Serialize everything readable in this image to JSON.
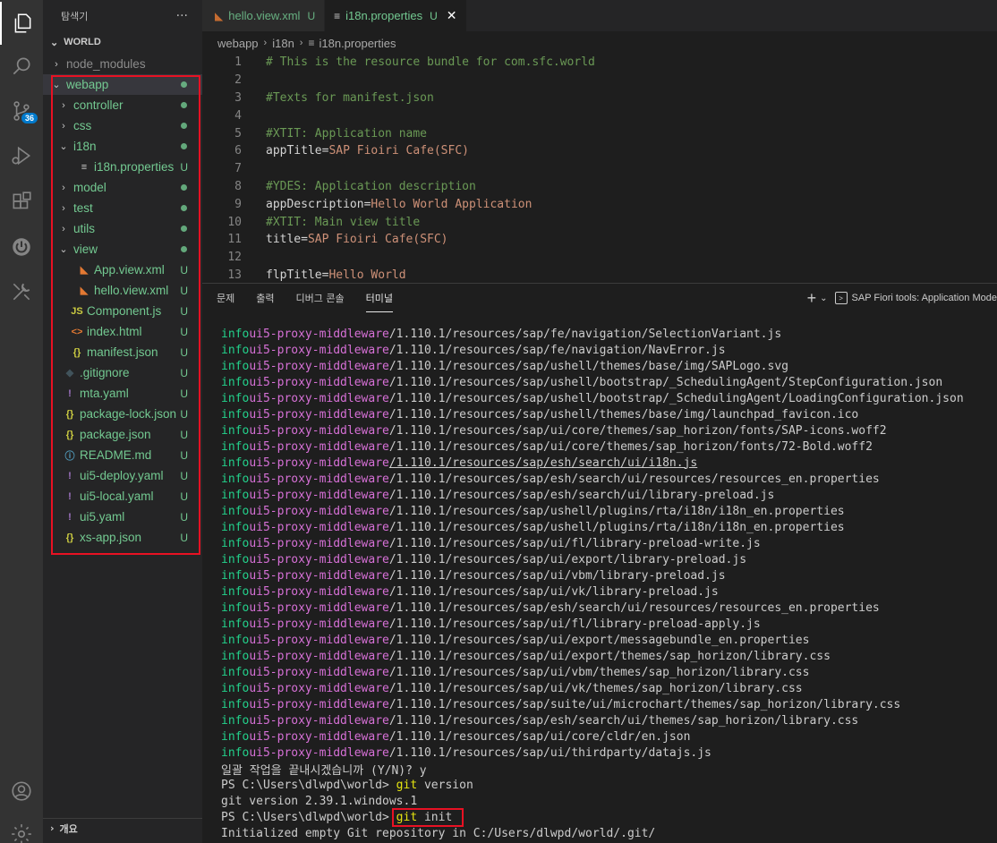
{
  "activity_bar": {
    "items": [
      {
        "icon": "explorer-icon"
      },
      {
        "icon": "search-icon"
      },
      {
        "icon": "source-control-icon",
        "badge": "36"
      },
      {
        "icon": "run-debug-icon"
      },
      {
        "icon": "extensions-icon"
      },
      {
        "icon": "sap-fiori-icon"
      },
      {
        "icon": "tools-icon"
      }
    ],
    "bottom": [
      {
        "icon": "account-icon"
      },
      {
        "icon": "settings-gear-icon"
      }
    ]
  },
  "sidebar": {
    "title": "탐색기",
    "more": "···",
    "root": "WORLD",
    "outline": "개요",
    "items": [
      {
        "label": "node_modules",
        "chev": "›",
        "depth": 0,
        "icon": "",
        "status": "",
        "color": "gray"
      },
      {
        "label": "webapp",
        "chev": "⌄",
        "depth": 0,
        "icon": "",
        "status": "dot",
        "color": "green",
        "selected": true
      },
      {
        "label": "controller",
        "chev": "›",
        "depth": 1,
        "icon": "",
        "status": "dot",
        "color": "green"
      },
      {
        "label": "css",
        "chev": "›",
        "depth": 1,
        "icon": "",
        "status": "dot",
        "color": "green"
      },
      {
        "label": "i18n",
        "chev": "⌄",
        "depth": 1,
        "icon": "",
        "status": "dot",
        "color": "green"
      },
      {
        "label": "i18n.properties",
        "chev": "",
        "depth": 2,
        "icon": "≡",
        "iconColor": "#cccccc",
        "status": "U",
        "color": "green"
      },
      {
        "label": "model",
        "chev": "›",
        "depth": 1,
        "icon": "",
        "status": "dot",
        "color": "green"
      },
      {
        "label": "test",
        "chev": "›",
        "depth": 1,
        "icon": "",
        "status": "dot",
        "color": "green"
      },
      {
        "label": "utils",
        "chev": "›",
        "depth": 1,
        "icon": "",
        "status": "dot",
        "color": "green"
      },
      {
        "label": "view",
        "chev": "⌄",
        "depth": 1,
        "icon": "",
        "status": "dot",
        "color": "green"
      },
      {
        "label": "App.view.xml",
        "chev": "",
        "depth": 2,
        "icon": "◣",
        "iconColor": "#e37933",
        "status": "U",
        "color": "green"
      },
      {
        "label": "hello.view.xml",
        "chev": "",
        "depth": 2,
        "icon": "◣",
        "iconColor": "#e37933",
        "status": "U",
        "color": "green"
      },
      {
        "label": "Component.js",
        "chev": "",
        "depth": 1,
        "icon": "JS",
        "iconColor": "#cbcb41",
        "status": "U",
        "color": "green"
      },
      {
        "label": "index.html",
        "chev": "",
        "depth": 1,
        "icon": "<>",
        "iconColor": "#e37933",
        "status": "U",
        "color": "green"
      },
      {
        "label": "manifest.json",
        "chev": "",
        "depth": 1,
        "icon": "{}",
        "iconColor": "#cbcb41",
        "status": "U",
        "color": "green"
      },
      {
        "label": ".gitignore",
        "chev": "",
        "depth": 0,
        "icon": "◆",
        "iconColor": "#41535b",
        "status": "U",
        "color": "green"
      },
      {
        "label": "mta.yaml",
        "chev": "",
        "depth": 0,
        "icon": "!",
        "iconColor": "#a074c4",
        "status": "U",
        "color": "green"
      },
      {
        "label": "package-lock.json",
        "chev": "",
        "depth": 0,
        "icon": "{}",
        "iconColor": "#cbcb41",
        "status": "U",
        "color": "green"
      },
      {
        "label": "package.json",
        "chev": "",
        "depth": 0,
        "icon": "{}",
        "iconColor": "#cbcb41",
        "status": "U",
        "color": "green"
      },
      {
        "label": "README.md",
        "chev": "",
        "depth": 0,
        "icon": "ⓘ",
        "iconColor": "#519aba",
        "status": "U",
        "color": "green"
      },
      {
        "label": "ui5-deploy.yaml",
        "chev": "",
        "depth": 0,
        "icon": "!",
        "iconColor": "#a074c4",
        "status": "U",
        "color": "green"
      },
      {
        "label": "ui5-local.yaml",
        "chev": "",
        "depth": 0,
        "icon": "!",
        "iconColor": "#a074c4",
        "status": "U",
        "color": "green"
      },
      {
        "label": "ui5.yaml",
        "chev": "",
        "depth": 0,
        "icon": "!",
        "iconColor": "#a074c4",
        "status": "U",
        "color": "green"
      },
      {
        "label": "xs-app.json",
        "chev": "",
        "depth": 0,
        "icon": "{}",
        "iconColor": "#cbcb41",
        "status": "U",
        "color": "green"
      }
    ]
  },
  "tabs": [
    {
      "label": "hello.view.xml",
      "icon": "◣",
      "status": "U",
      "active": false
    },
    {
      "label": "i18n.properties",
      "icon": "≡",
      "status": "U",
      "active": true,
      "close": "✕"
    }
  ],
  "breadcrumb": [
    "webapp",
    "i18n",
    "i18n.properties"
  ],
  "editor": {
    "lines": [
      {
        "n": "1",
        "type": "comment",
        "text": "# This is the resource bundle for com.sfc.world"
      },
      {
        "n": "2",
        "type": "blank",
        "text": ""
      },
      {
        "n": "3",
        "type": "comment",
        "text": "#Texts for manifest.json"
      },
      {
        "n": "4",
        "type": "blank",
        "text": ""
      },
      {
        "n": "5",
        "type": "comment",
        "text": "#XTIT: Application name"
      },
      {
        "n": "6",
        "type": "kv",
        "key": "appTitle",
        "value": "SAP Fioiri Cafe(SFC)"
      },
      {
        "n": "7",
        "type": "blank",
        "text": ""
      },
      {
        "n": "8",
        "type": "comment",
        "text": "#YDES: Application description"
      },
      {
        "n": "9",
        "type": "kv",
        "key": "appDescription",
        "value": "Hello World Application"
      },
      {
        "n": "10",
        "type": "comment",
        "text": "#XTIT: Main view title"
      },
      {
        "n": "11",
        "type": "kv",
        "key": "title",
        "value": "SAP Fioiri Cafe(SFC)"
      },
      {
        "n": "12",
        "type": "blank",
        "text": ""
      },
      {
        "n": "13",
        "type": "kv",
        "key": "flpTitle",
        "value": "Hello World"
      }
    ]
  },
  "panel": {
    "tabs": [
      "문제",
      "출력",
      "디버그 콘솔",
      "터미널"
    ],
    "active_tab": "터미널",
    "plus": "+",
    "dropdown": "⌄",
    "terminal_name": "SAP Fiori tools: Application Mode"
  },
  "terminal": {
    "log_level": "info",
    "middleware": "ui5-proxy-middleware",
    "paths": [
      "/1.110.1/resources/sap/fe/navigation/SelectionVariant.js",
      "/1.110.1/resources/sap/fe/navigation/NavError.js",
      "/1.110.1/resources/sap/ushell/themes/base/img/SAPLogo.svg",
      "/1.110.1/resources/sap/ushell/bootstrap/_SchedulingAgent/StepConfiguration.json",
      "/1.110.1/resources/sap/ushell/bootstrap/_SchedulingAgent/LoadingConfiguration.json",
      "/1.110.1/resources/sap/ushell/themes/base/img/launchpad_favicon.ico",
      "/1.110.1/resources/sap/ui/core/themes/sap_horizon/fonts/SAP-icons.woff2",
      "/1.110.1/resources/sap/ui/core/themes/sap_horizon/fonts/72-Bold.woff2",
      "/1.110.1/resources/sap/esh/search/ui/i18n.js",
      "/1.110.1/resources/sap/esh/search/ui/resources/resources_en.properties",
      "/1.110.1/resources/sap/esh/search/ui/library-preload.js",
      "/1.110.1/resources/sap/ushell/plugins/rta/i18n/i18n_en.properties",
      "/1.110.1/resources/sap/ushell/plugins/rta/i18n/i18n_en.properties",
      "/1.110.1/resources/sap/ui/fl/library-preload-write.js",
      "/1.110.1/resources/sap/ui/export/library-preload.js",
      "/1.110.1/resources/sap/ui/vbm/library-preload.js",
      "/1.110.1/resources/sap/ui/vk/library-preload.js",
      "/1.110.1/resources/sap/esh/search/ui/resources/resources_en.properties",
      "/1.110.1/resources/sap/ui/fl/library-preload-apply.js",
      "/1.110.1/resources/sap/ui/export/messagebundle_en.properties",
      "/1.110.1/resources/sap/ui/export/themes/sap_horizon/library.css",
      "/1.110.1/resources/sap/ui/vbm/themes/sap_horizon/library.css",
      "/1.110.1/resources/sap/ui/vk/themes/sap_horizon/library.css",
      "/1.110.1/resources/sap/suite/ui/microchart/themes/sap_horizon/library.css",
      "/1.110.1/resources/sap/esh/search/ui/themes/sap_horizon/library.css",
      "/1.110.1/resources/sap/ui/core/cldr/en.json",
      "/1.110.1/resources/sap/ui/thirdparty/datajs.js"
    ],
    "underlined_index": 8,
    "tail": [
      {
        "type": "plain",
        "text": "일괄 작업을 끝내시겠습니까 (Y/N)? y"
      },
      {
        "type": "cmd",
        "prompt": "PS C:\\Users\\dlwpd\\world> ",
        "cmd": "git",
        "rest": " version"
      },
      {
        "type": "plain",
        "text": "git version 2.39.1.windows.1"
      },
      {
        "type": "cmd",
        "prompt": "PS C:\\Users\\dlwpd\\world> ",
        "cmd": "git",
        "rest": " init"
      },
      {
        "type": "plain",
        "text": "Initialized empty Git repository in C:/Users/dlwpd/world/.git/"
      }
    ]
  },
  "colors": {
    "accent": "#007acc",
    "git_untracked": "#73c991",
    "highlight": "#e81123",
    "term_info": "#23d18b",
    "term_middleware": "#d670d6"
  }
}
